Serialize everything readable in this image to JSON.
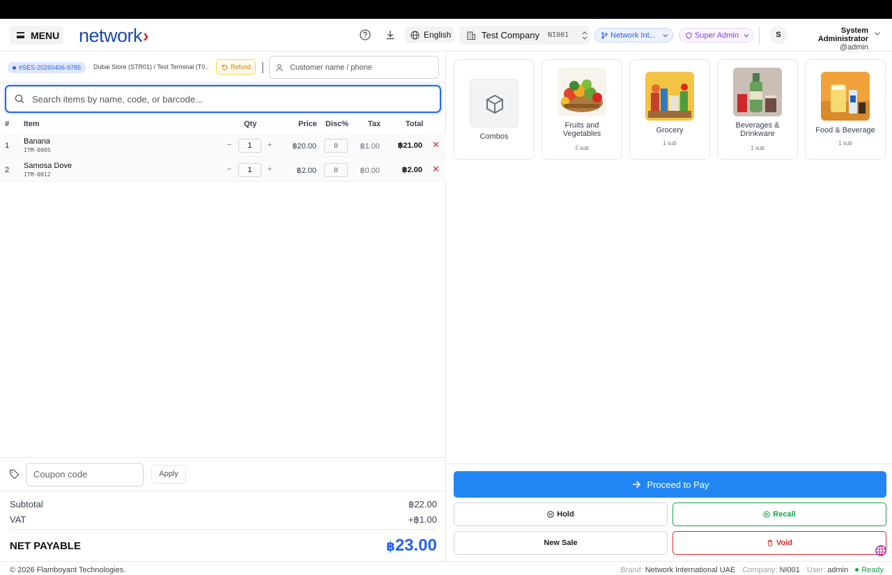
{
  "header": {
    "menu_label": "MENU",
    "logo_text": "network",
    "logo_chevron": "›",
    "help_icon": "help-circle-icon",
    "download_icon": "download-icon",
    "language": "English",
    "company_name": "Test Company",
    "company_code": "NI001",
    "network_pill": "Network Int...",
    "role_pill": "Super Admin",
    "avatar_initial": "S",
    "user_name": "System Administrator",
    "user_handle": "@admin"
  },
  "session": {
    "session_id": "#SES-20260406-9785",
    "store_terminal": "Dubai Store (STR01) / Test Terminal (T0...",
    "refund_label": "Refund",
    "customer_placeholder": "Customer name / phone"
  },
  "search": {
    "placeholder": "Search items by name, code, or barcode..."
  },
  "table": {
    "columns": [
      "#",
      "Item",
      "Qty",
      "Price",
      "Disc%",
      "Tax",
      "Total"
    ],
    "rows": [
      {
        "index": "1",
        "name": "Banana",
        "code": "ITM-0005",
        "qty": "1",
        "price": "20.00",
        "disc": "0",
        "tax": "1.00",
        "total": "21.00"
      },
      {
        "index": "2",
        "name": "Samosa Dove",
        "code": "ITM-0012",
        "qty": "1",
        "price": "2.00",
        "disc": "0",
        "tax": "0.00",
        "total": "2.00"
      }
    ]
  },
  "coupon": {
    "placeholder": "Coupon code",
    "apply_label": "Apply"
  },
  "totals": {
    "currency_symbol": "฿",
    "subtotal_label": "Subtotal",
    "subtotal_value": "22.00",
    "vat_label": "VAT",
    "vat_value": "+฿1.00",
    "net_label": "NET PAYABLE",
    "net_value": "23.00"
  },
  "categories": [
    {
      "label": "Combos",
      "sub": ""
    },
    {
      "label": "Fruits and Vegetables",
      "sub": "2 sub"
    },
    {
      "label": "Grocery",
      "sub": "1 sub"
    },
    {
      "label": "Beverages & Drinkware",
      "sub": "1 sub"
    },
    {
      "label": "Food & Beverage",
      "sub": "1 sub"
    }
  ],
  "actions": {
    "proceed_label": "Proceed to Pay",
    "hold_label": "Hold",
    "recall_label": "Recall",
    "new_sale_label": "New Sale",
    "void_label": "Void"
  },
  "footer": {
    "copyright": "© 2026 Flamboyant Technologies.",
    "brand_key": "Brand:",
    "brand_value": "Network International UAE",
    "company_key": "Company:",
    "company_value": "NI001",
    "user_key": "User:",
    "user_value": "admin",
    "status": "Ready"
  },
  "colors": {
    "accent": "#2186f3",
    "brand_blue": "#1d4aa8",
    "brand_red": "#d0312d",
    "recall_green": "#16a34a",
    "void_red": "#dc2626"
  }
}
